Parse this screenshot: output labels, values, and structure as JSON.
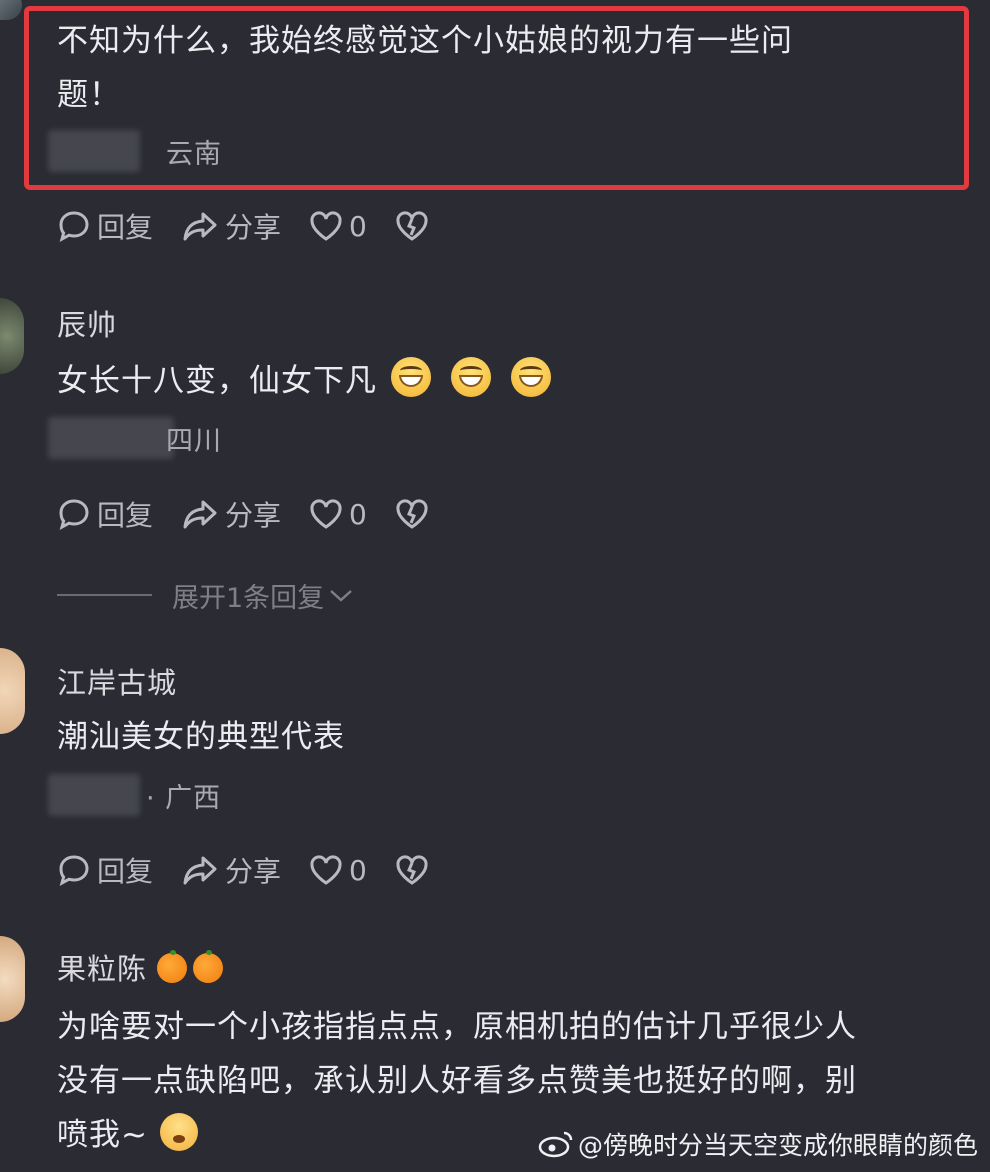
{
  "comments": [
    {
      "text_lines": [
        "不知为什么，我始终感觉这个小姑娘的视力有一些问",
        "题！"
      ],
      "location": "云南",
      "actions": {
        "reply": "回复",
        "share": "分享",
        "likes": "0"
      }
    },
    {
      "username": "辰帅",
      "text": "女长十八变，仙女下凡",
      "location": "四川",
      "actions": {
        "reply": "回复",
        "share": "分享",
        "likes": "0"
      },
      "expand_label": "展开1条回复"
    },
    {
      "username": "江岸古城",
      "text": "潮汕美女的典型代表",
      "location": "· 广西",
      "actions": {
        "reply": "回复",
        "share": "分享",
        "likes": "0"
      }
    },
    {
      "username": "果粒陈",
      "text_lines": [
        "为啥要对一个小孩指指点点，原相机拍的估计几乎很少人",
        "没有一点缺陷吧，承认别人好看多点赞美也挺好的啊，别",
        "喷我~"
      ]
    }
  ],
  "watermark": "@傍晚时分当天空变成你眼睛的颜色",
  "colors": {
    "background": "#2a2b33",
    "highlight": "#e23a3f"
  }
}
